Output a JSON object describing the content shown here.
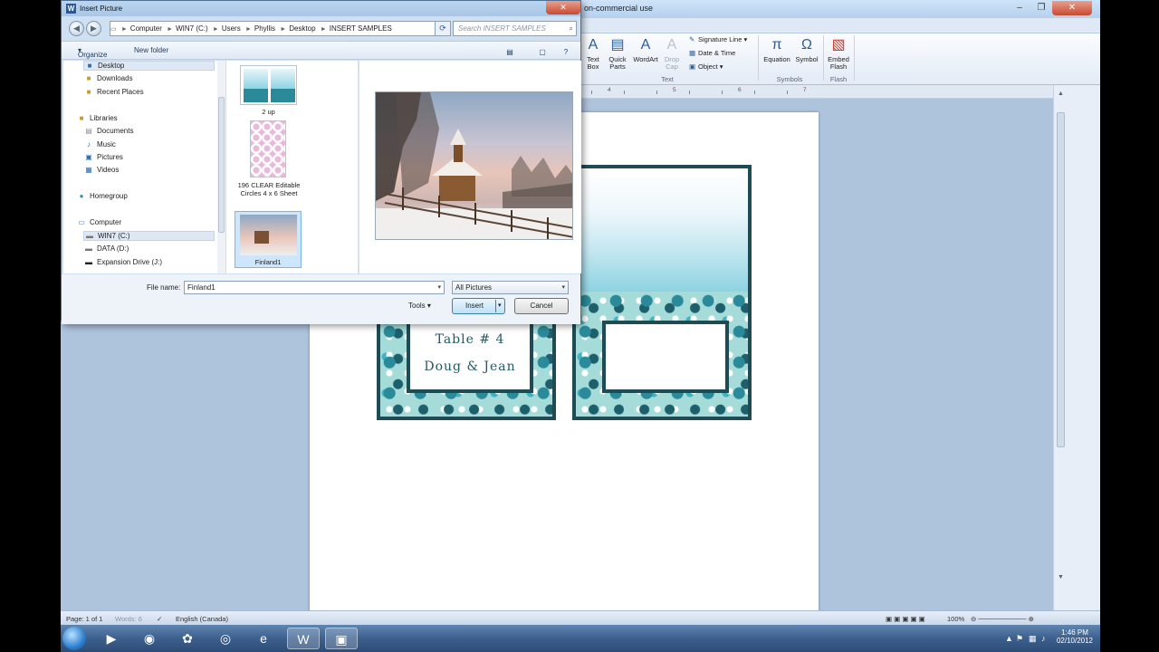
{
  "word": {
    "title_fragment": "on-commercial use",
    "ribbon": {
      "text_box": "Text Box",
      "quick_parts": "Quick Parts",
      "wordart": "WordArt",
      "drop_cap": "Drop Cap",
      "signature_line": "Signature Line",
      "date_time": "Date & Time",
      "object": "Object",
      "equation": "Equation",
      "symbol": "Symbol",
      "embed_flash": "Embed Flash",
      "group_text": "Text",
      "group_symbols": "Symbols",
      "group_flash": "Flash"
    },
    "ruler_numbers": [
      "4",
      "5",
      "6",
      "7"
    ],
    "card": {
      "line1": "Table # 4",
      "line2": "Doug & Jean"
    },
    "status": {
      "page": "Page: 1 of 1",
      "words": "Words: 6",
      "language": "English (Canada)",
      "zoom": "100%"
    }
  },
  "taskbar": {
    "time": "1:46 PM",
    "date": "02/10/2012"
  },
  "dialog": {
    "title": "Insert Picture",
    "breadcrumb": [
      "Computer",
      "WIN7 (C:)",
      "Users",
      "Phyllis",
      "Desktop",
      "INSERT SAMPLES"
    ],
    "search_placeholder": "Search INSERT SAMPLES",
    "organize": "Organize",
    "new_folder": "New folder",
    "nav": {
      "desktop": "Desktop",
      "downloads": "Downloads",
      "recent_places": "Recent Places",
      "libraries": "Libraries",
      "documents": "Documents",
      "music": "Music",
      "pictures": "Pictures",
      "videos": "Videos",
      "homegroup": "Homegroup",
      "computer": "Computer",
      "win7": "WIN7 (C:)",
      "data": "DATA (D:)",
      "expansion": "Expansion Drive (J:)"
    },
    "files": {
      "f1": "2 up",
      "f2": "196 CLEAR Editable Circles 4 x 6 Sheet",
      "f3": "Finland1"
    },
    "file_name_label": "File name:",
    "file_name_value": "Finland1",
    "filter": "All Pictures",
    "tools": "Tools",
    "insert": "Insert",
    "cancel": "Cancel"
  }
}
